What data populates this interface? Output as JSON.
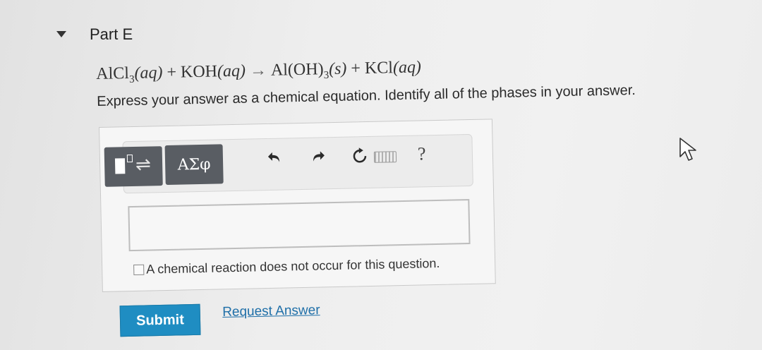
{
  "section": {
    "title": "Part E"
  },
  "equation": {
    "reactant1": "AlCl",
    "reactant1_sub": "3",
    "reactant1_phase": "(aq)",
    "plus1": " + ",
    "reactant2": "KOH",
    "reactant2_phase": "(aq)",
    "arrow": "→",
    "product1": "Al(OH)",
    "product1_sub": "3",
    "product1_phase": "(s)",
    "plus2": " + ",
    "product2": "KCl",
    "product2_phase": "(aq)"
  },
  "instruction": "Express your answer as a chemical equation. Identify all of the phases in your answer.",
  "toolbar": {
    "greek_label": "ΑΣφ",
    "undo_icon": "undo-icon",
    "redo_icon": "redo-icon",
    "reset_icon": "reset-icon",
    "keyboard_icon": "keyboard-icon",
    "help_label": "?"
  },
  "answer": {
    "value": ""
  },
  "no_reaction": {
    "label": "A chemical reaction does not occur for this question.",
    "checked": false
  },
  "actions": {
    "submit_label": "Submit",
    "request_answer_label": "Request Answer"
  },
  "colors": {
    "submit_bg": "#1f8dc2",
    "toolbar_button_bg": "#595d63",
    "link": "#1f6fa8"
  }
}
